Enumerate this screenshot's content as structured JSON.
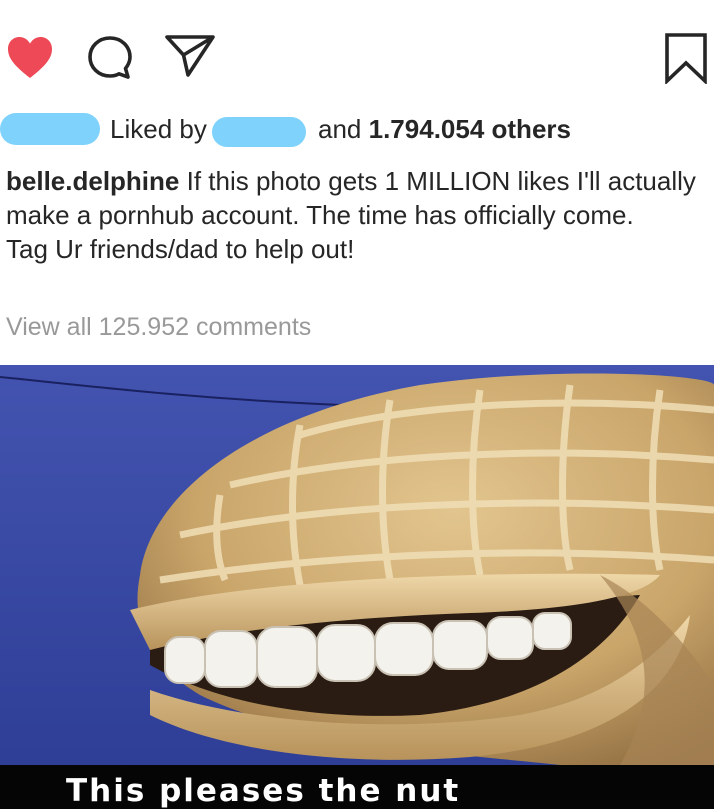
{
  "actions": {
    "like_icon": "heart-icon",
    "comment_icon": "comment-icon",
    "share_icon": "paper-plane-icon",
    "save_icon": "bookmark-icon",
    "like_color": "#ed4956"
  },
  "likes": {
    "liked_by_label": "Liked by",
    "and_label": "and",
    "others_count": "1.794.054 others",
    "redaction_color": "#7fd2fb"
  },
  "caption": {
    "username": "belle.delphine",
    "text_line1": " If this photo gets 1 MILLION likes I'll actually make a pornhub account. The time has officially come.",
    "text_line2": "Tag Ur friends/dad to help out!"
  },
  "comments": {
    "view_all_label": "View all 125.952 comments"
  },
  "photo": {
    "meme_caption": "This pleases the nut",
    "sky_color": "#3d4da8",
    "subject": "smiling peanut statue"
  }
}
